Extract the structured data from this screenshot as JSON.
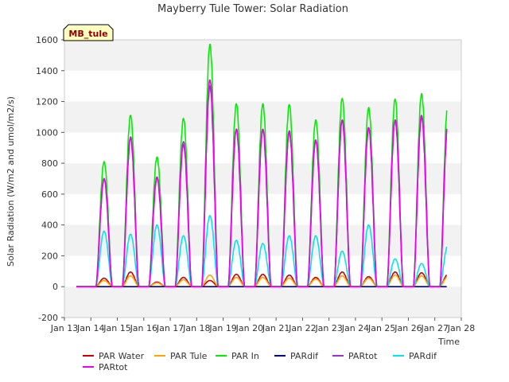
{
  "chart_data": {
    "type": "line",
    "title": "Mayberry Tule Tower: Solar Radiation",
    "xlabel": "Time",
    "ylabel": "Solar Radiation (W/m2 and umol/m2/s)",
    "station_label": "MB_tule",
    "ylim": [
      -200,
      1600
    ],
    "yticks": [
      -200,
      0,
      200,
      400,
      600,
      800,
      1000,
      1200,
      1400,
      1600
    ],
    "ytick_labels": [
      "-200",
      "0",
      "200",
      "400",
      "600",
      "800",
      "1000",
      "1200",
      "1400",
      "1600"
    ],
    "xlim": [
      13,
      28
    ],
    "xticks": [
      13,
      14,
      15,
      16,
      17,
      18,
      19,
      20,
      21,
      22,
      23,
      24,
      25,
      26,
      27,
      28
    ],
    "xtick_labels": [
      "Jan 13",
      "Jan 14",
      "Jan 15",
      "Jan 16",
      "Jan 17",
      "Jan 18",
      "Jan 19",
      "Jan 20",
      "Jan 21",
      "Jan 22",
      "Jan 23",
      "Jan 24",
      "Jan 25",
      "Jan 26",
      "Jan 27",
      "Jan 28"
    ],
    "grid": "horizontal bands",
    "legend_position": "bottom",
    "day_centers": [
      14.5,
      15.5,
      16.5,
      17.5,
      18.5,
      19.5,
      20.5,
      21.5,
      22.5,
      23.5,
      24.5,
      25.5,
      26.5,
      27.5
    ],
    "series": [
      {
        "name": "PAR Water",
        "color": "#cc0000",
        "peaks": [
          55,
          95,
          30,
          60,
          40,
          80,
          80,
          75,
          60,
          95,
          65,
          95,
          90,
          80
        ]
      },
      {
        "name": "PAR Tule",
        "color": "#ffa500",
        "peaks": [
          40,
          70,
          25,
          45,
          75,
          60,
          60,
          55,
          50,
          70,
          55,
          75,
          70,
          65
        ]
      },
      {
        "name": "PAR In",
        "color": "#00ee00",
        "peaks": [
          810,
          1110,
          840,
          1090,
          1570,
          1185,
          1185,
          1180,
          1080,
          1220,
          1160,
          1215,
          1250,
          1210
        ]
      },
      {
        "name": "PARdif",
        "color": "#00008b",
        "peaks": [
          0,
          0,
          0,
          0,
          0,
          0,
          0,
          0,
          0,
          0,
          0,
          0,
          0,
          0
        ]
      },
      {
        "name": "PARtot",
        "color": "#9932cc",
        "peaks": [
          700,
          960,
          710,
          940,
          1300,
          1020,
          1020,
          1010,
          950,
          1080,
          1030,
          1080,
          1100,
          1070
        ]
      },
      {
        "name": "PARdif",
        "color": "#00e5ee",
        "peaks": [
          360,
          340,
          400,
          330,
          460,
          300,
          280,
          330,
          330,
          230,
          400,
          180,
          150,
          270
        ]
      },
      {
        "name": "PARtot",
        "color": "#ee00ee",
        "peaks": [
          700,
          970,
          710,
          920,
          1340,
          1020,
          1020,
          1000,
          950,
          1080,
          1030,
          1080,
          1110,
          1070
        ]
      }
    ]
  }
}
